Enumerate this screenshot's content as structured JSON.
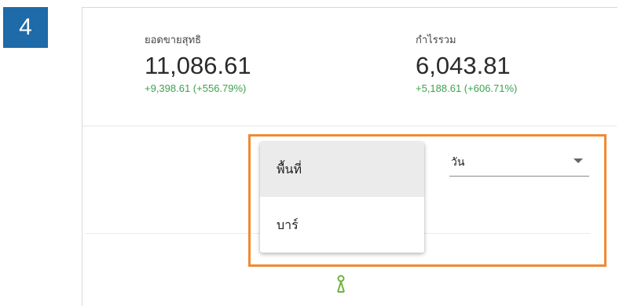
{
  "step": {
    "number": "4"
  },
  "metrics": [
    {
      "label": "ยอดขายสุทธิ",
      "value": "11,086.61",
      "change": "+9,398.61 (+556.79%)"
    },
    {
      "label": "กำไรรวม",
      "value": "6,043.81",
      "change": "+5,188.61 (+606.71%)"
    }
  ],
  "period_select": {
    "value": "วัน",
    "icon": "chevron-down-icon"
  },
  "chart_type_menu": {
    "items": [
      {
        "label": "พื้นที่",
        "highlighted": true
      },
      {
        "label": "บาร์",
        "highlighted": false
      }
    ]
  },
  "colors": {
    "badge": "#1f6aa8",
    "positive": "#3da24f",
    "highlight_border": "#ef8a34",
    "marker": "#6db33f"
  }
}
